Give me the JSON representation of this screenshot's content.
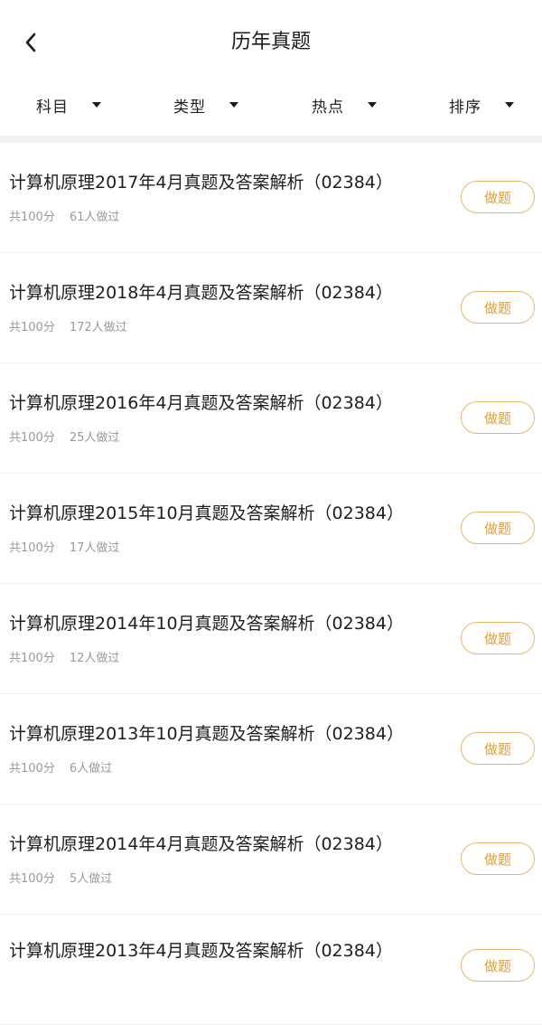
{
  "header": {
    "title": "历年真题"
  },
  "filters": [
    {
      "label": "科目"
    },
    {
      "label": "类型"
    },
    {
      "label": "热点"
    },
    {
      "label": "排序"
    }
  ],
  "items": [
    {
      "title": "计算机原理2017年4月真题及答案解析（02384）",
      "score": "共100分",
      "count": "61人做过",
      "button": "做题"
    },
    {
      "title": "计算机原理2018年4月真题及答案解析（02384）",
      "score": "共100分",
      "count": "172人做过",
      "button": "做题"
    },
    {
      "title": "计算机原理2016年4月真题及答案解析（02384）",
      "score": "共100分",
      "count": "25人做过",
      "button": "做题"
    },
    {
      "title": "计算机原理2015年10月真题及答案解析（02384）",
      "score": "共100分",
      "count": "17人做过",
      "button": "做题"
    },
    {
      "title": "计算机原理2014年10月真题及答案解析（02384）",
      "score": "共100分",
      "count": "12人做过",
      "button": "做题"
    },
    {
      "title": "计算机原理2013年10月真题及答案解析（02384）",
      "score": "共100分",
      "count": "6人做过",
      "button": "做题"
    },
    {
      "title": "计算机原理2014年4月真题及答案解析（02384）",
      "score": "共100分",
      "count": "5人做过",
      "button": "做题"
    },
    {
      "title": "计算机原理2013年4月真题及答案解析（02384）",
      "score": "",
      "count": "",
      "button": "做题"
    }
  ],
  "colors": {
    "accent": "#d9a045",
    "accent_border": "#e6b86a",
    "meta_text": "#9a9a9a"
  },
  "icons": {
    "back": "chevron-left-icon",
    "dropdown": "caret-down-icon"
  }
}
